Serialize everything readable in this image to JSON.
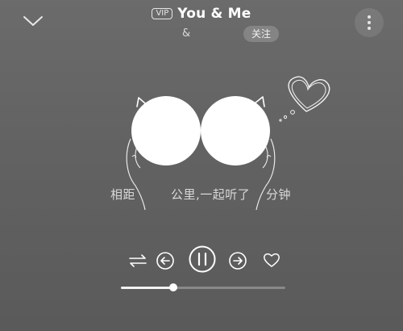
{
  "header": {
    "vip_label": "VIP",
    "song_title": "You & Me",
    "artist_separator": "&",
    "follow_label": "关注",
    "collapse_icon": "chevron-down-icon",
    "more_icon": "more-vertical-icon"
  },
  "center": {
    "avatar_left": "avatar",
    "avatar_right": "avatar",
    "decor_icon": "heart-doodle-icon",
    "distance_prefix": "相距",
    "distance_middle": "公里,一起听了",
    "distance_suffix": "分钟"
  },
  "controls": {
    "repeat_icon": "repeat-icon",
    "prev_icon": "previous-icon",
    "play_pause_icon": "pause-icon",
    "next_icon": "next-icon",
    "like_icon": "heart-icon"
  },
  "progress": {
    "fraction": 0.32
  },
  "colors": {
    "background": "#636363",
    "text": "#ffffff",
    "muted_text": "#d8d8d8"
  }
}
